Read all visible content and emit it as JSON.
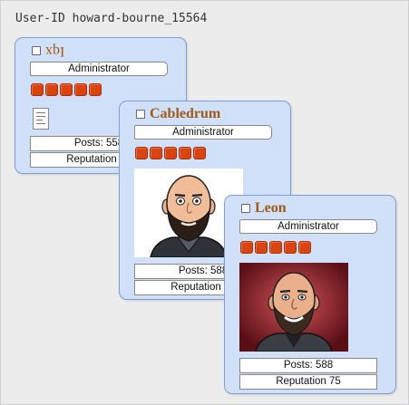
{
  "header": {
    "user_id": "User-ID howard-bourne_15564"
  },
  "cards": [
    {
      "username": "Iqx",
      "rank": "Administrator",
      "posts": "Posts: 558",
      "reputation": "Reputation 75",
      "rating_pips": 5,
      "avatar_icon": "document-icon"
    },
    {
      "username": "Cabledrum",
      "rank": "Administrator",
      "posts": "Posts: 588",
      "reputation": "Reputation 75",
      "rating_pips": 5,
      "avatar_icon": "avatar-cartoon-bald-bearded"
    },
    {
      "username": "Leon",
      "rank": "Administrator",
      "posts": "Posts: 588",
      "reputation": "Reputation 75",
      "rating_pips": 5,
      "avatar_icon": "avatar-cartoon-bald-bearded-red-bg"
    }
  ],
  "colors": {
    "card_bg": "#cfe0f8",
    "card_border": "#7f9fd3",
    "username": "#a05a17",
    "pip": "#d94410"
  }
}
